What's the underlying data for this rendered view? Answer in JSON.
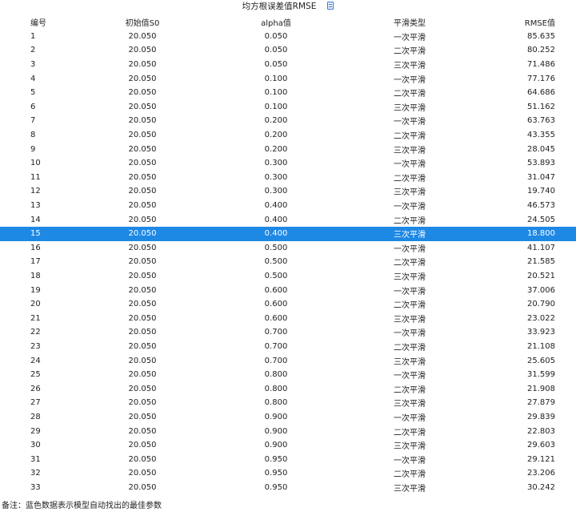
{
  "title": "均方根误差值RMSE",
  "headers": [
    "编号",
    "初始值S0",
    "alpha值",
    "平滑类型",
    "RMSE值"
  ],
  "selected_row": 15,
  "accent_color": "#1e88e5",
  "rows": [
    [
      "1",
      "20.050",
      "0.050",
      "一次平滑",
      "85.635"
    ],
    [
      "2",
      "20.050",
      "0.050",
      "二次平滑",
      "80.252"
    ],
    [
      "3",
      "20.050",
      "0.050",
      "三次平滑",
      "71.486"
    ],
    [
      "4",
      "20.050",
      "0.100",
      "一次平滑",
      "77.176"
    ],
    [
      "5",
      "20.050",
      "0.100",
      "二次平滑",
      "64.686"
    ],
    [
      "6",
      "20.050",
      "0.100",
      "三次平滑",
      "51.162"
    ],
    [
      "7",
      "20.050",
      "0.200",
      "一次平滑",
      "63.763"
    ],
    [
      "8",
      "20.050",
      "0.200",
      "二次平滑",
      "43.355"
    ],
    [
      "9",
      "20.050",
      "0.200",
      "三次平滑",
      "28.045"
    ],
    [
      "10",
      "20.050",
      "0.300",
      "一次平滑",
      "53.893"
    ],
    [
      "11",
      "20.050",
      "0.300",
      "二次平滑",
      "31.047"
    ],
    [
      "12",
      "20.050",
      "0.300",
      "三次平滑",
      "19.740"
    ],
    [
      "13",
      "20.050",
      "0.400",
      "一次平滑",
      "46.573"
    ],
    [
      "14",
      "20.050",
      "0.400",
      "二次平滑",
      "24.505"
    ],
    [
      "15",
      "20.050",
      "0.400",
      "三次平滑",
      "18.800"
    ],
    [
      "16",
      "20.050",
      "0.500",
      "一次平滑",
      "41.107"
    ],
    [
      "17",
      "20.050",
      "0.500",
      "二次平滑",
      "21.585"
    ],
    [
      "18",
      "20.050",
      "0.500",
      "三次平滑",
      "20.521"
    ],
    [
      "19",
      "20.050",
      "0.600",
      "一次平滑",
      "37.006"
    ],
    [
      "20",
      "20.050",
      "0.600",
      "二次平滑",
      "20.790"
    ],
    [
      "21",
      "20.050",
      "0.600",
      "三次平滑",
      "23.022"
    ],
    [
      "22",
      "20.050",
      "0.700",
      "一次平滑",
      "33.923"
    ],
    [
      "23",
      "20.050",
      "0.700",
      "二次平滑",
      "21.108"
    ],
    [
      "24",
      "20.050",
      "0.700",
      "三次平滑",
      "25.605"
    ],
    [
      "25",
      "20.050",
      "0.800",
      "一次平滑",
      "31.599"
    ],
    [
      "26",
      "20.050",
      "0.800",
      "二次平滑",
      "21.908"
    ],
    [
      "27",
      "20.050",
      "0.800",
      "三次平滑",
      "27.879"
    ],
    [
      "28",
      "20.050",
      "0.900",
      "一次平滑",
      "29.839"
    ],
    [
      "29",
      "20.050",
      "0.900",
      "二次平滑",
      "22.803"
    ],
    [
      "30",
      "20.050",
      "0.900",
      "三次平滑",
      "29.603"
    ],
    [
      "31",
      "20.050",
      "0.950",
      "一次平滑",
      "29.121"
    ],
    [
      "32",
      "20.050",
      "0.950",
      "二次平滑",
      "23.206"
    ],
    [
      "33",
      "20.050",
      "0.950",
      "三次平滑",
      "30.242"
    ]
  ],
  "footer": "备注：蓝色数据表示模型自动找出的最佳参数"
}
